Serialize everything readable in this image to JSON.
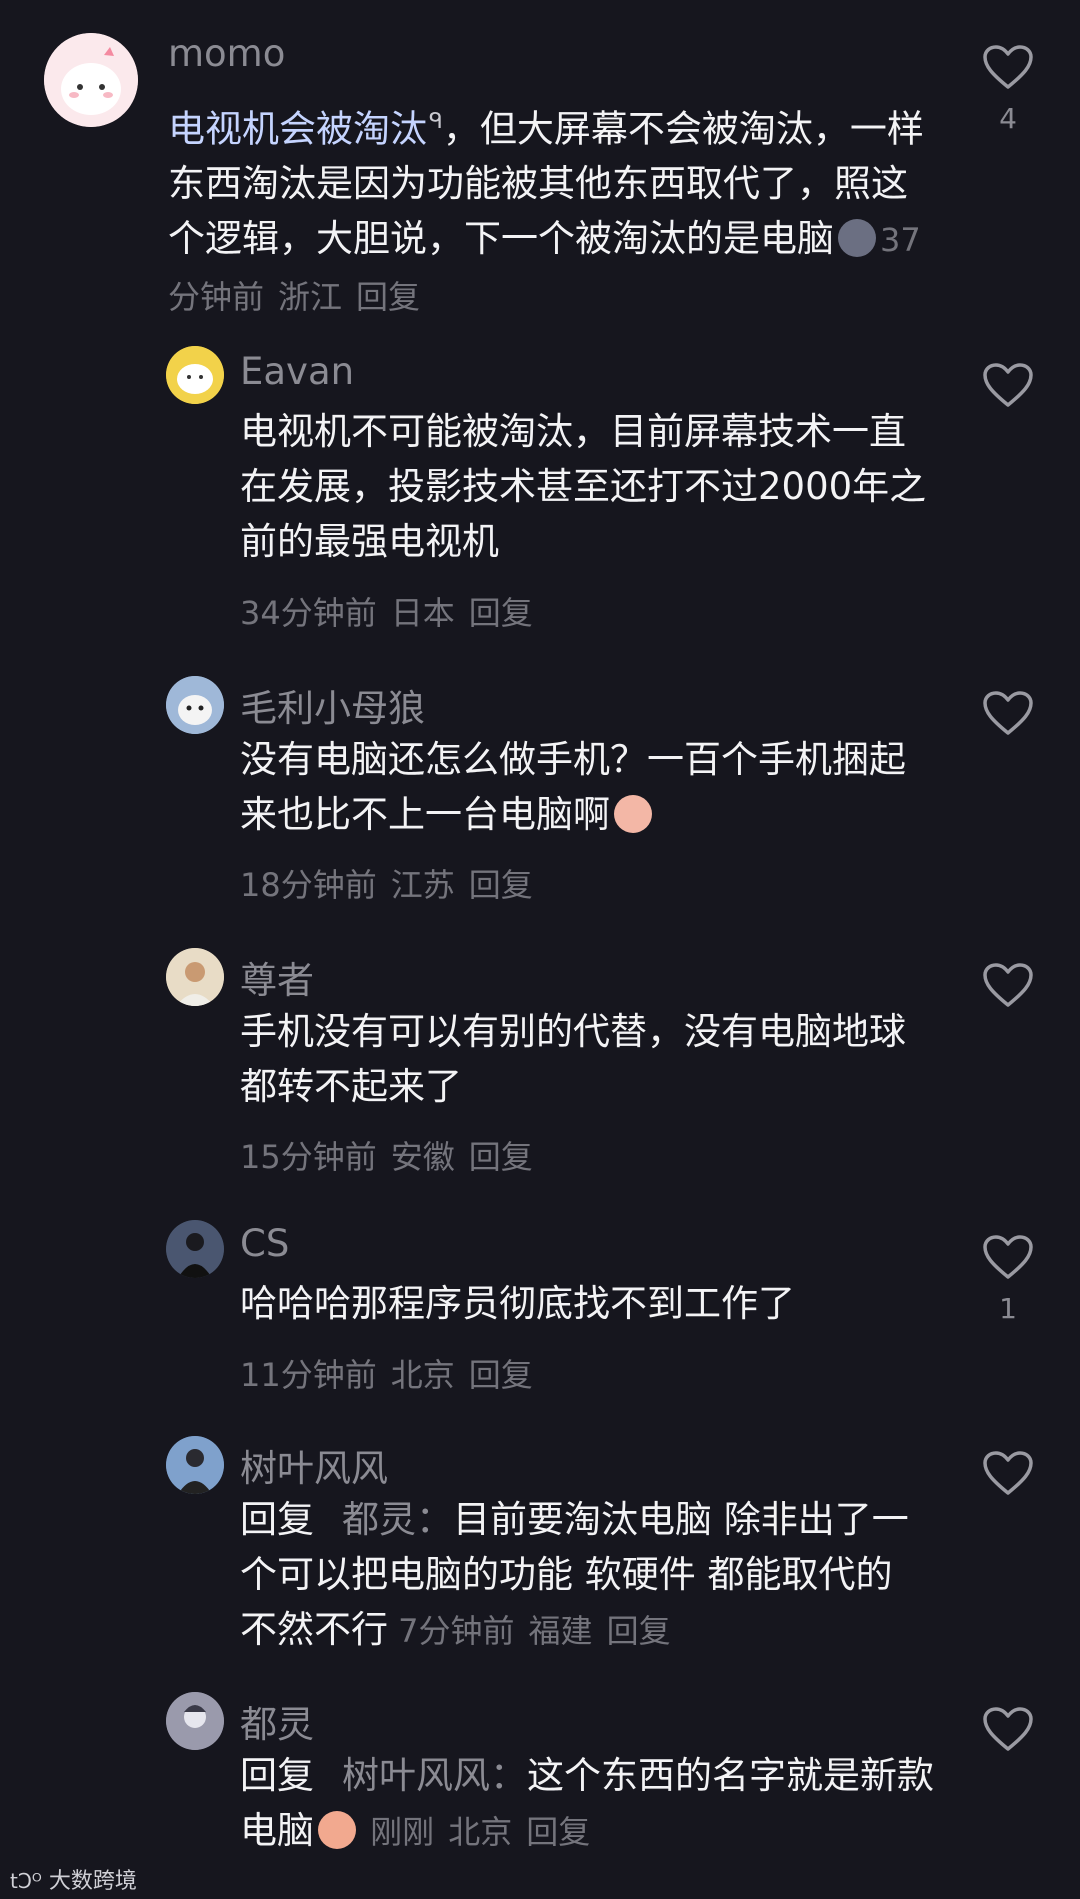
{
  "comments": [
    {
      "username": "momo",
      "text_link": "电视机会被淘汰",
      "text": "，但大屏幕不会被淘汰，一样东西淘汰是因为功能被其他东西取代了，照这个逻辑，大胆说，下一个被淘汰的是电脑",
      "time": "37分钟前",
      "location": "浙江",
      "reply_label": "回复",
      "likes": "4",
      "avatar_color": "#f6dfe4"
    },
    {
      "username": "Eavan",
      "text": "电视机不可能被淘汰，目前屏幕技术一直在发展，投影技术甚至还打不过2000年之前的最强电视机",
      "time": "34分钟前",
      "location": "日本",
      "reply_label": "回复",
      "avatar_color": "#f2d24a"
    },
    {
      "username": "毛利小母狼",
      "text": "没有电脑还怎么做手机？一百个手机捆起来也比不上一台电脑啊",
      "time": "18分钟前",
      "location": "江苏",
      "reply_label": "回复",
      "avatar_color": "#9fb8d8"
    },
    {
      "username": "尊者",
      "text": "手机没有可以有别的代替，没有电脑地球都转不起来了",
      "time": "15分钟前",
      "location": "安徽",
      "reply_label": "回复",
      "avatar_color": "#d8c9b0"
    },
    {
      "username": "CS",
      "text": "哈哈哈那程序员彻底找不到工作了",
      "time": "11分钟前",
      "location": "北京",
      "reply_label": "回复",
      "likes": "1",
      "avatar_color": "#3a4456"
    },
    {
      "username": "树叶风风",
      "reply_word": "回复",
      "reply_to": "都灵：",
      "text": "目前要淘汰电脑 除非出了一个可以把电脑的功能 软硬件 都能取代的 不然不行",
      "time": "7分钟前",
      "location": "福建",
      "reply_label": "回复",
      "avatar_color": "#6a8cb8"
    },
    {
      "username": "都灵",
      "reply_word": "回复",
      "reply_to": "树叶风风：",
      "text": "这个东西的名字就是新款电脑",
      "time": "刚刚",
      "location": "北京",
      "reply_label": "回复",
      "avatar_color": "#8e8ea0"
    }
  ],
  "watermark": "大数跨境"
}
